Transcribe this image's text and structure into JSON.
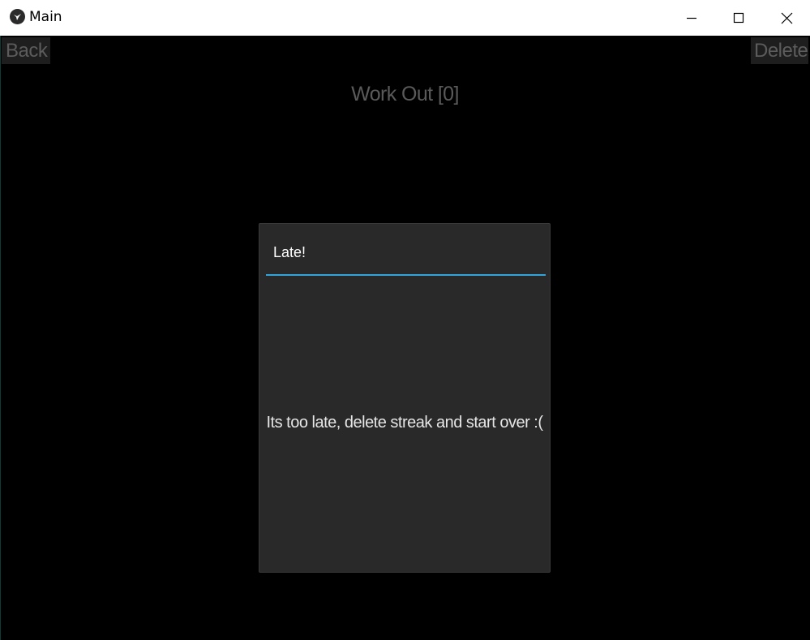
{
  "window": {
    "title": "Main",
    "icon": "kivy-app-icon",
    "controls": {
      "minimize": "minimize-icon",
      "maximize": "maximize-icon",
      "close": "close-icon"
    }
  },
  "header": {
    "back_label": "Back",
    "delete_label": "Delete",
    "title": "Work Out [0]"
  },
  "popup": {
    "title": "Late!",
    "message": "Its too late, delete streak and start over :("
  },
  "colors": {
    "background": "#000000",
    "popup_bg": "#292929",
    "accent": "#33a4d9",
    "button_bg": "#1e1e1e",
    "muted_text": "#5a5a5a"
  }
}
